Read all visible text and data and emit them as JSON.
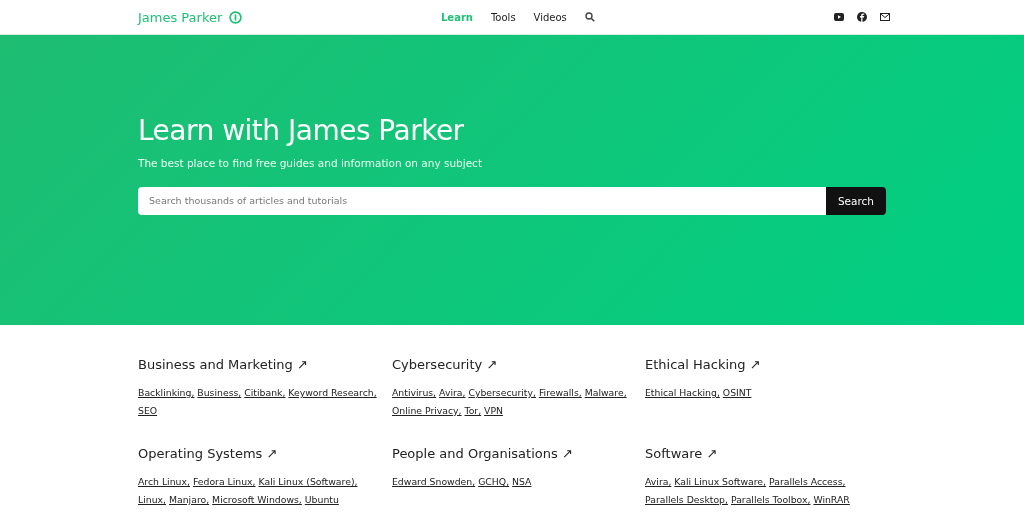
{
  "header": {
    "brand": "James Parker",
    "nav": [
      {
        "label": "Learn",
        "selected": true
      },
      {
        "label": "Tools",
        "selected": false
      },
      {
        "label": "Videos",
        "selected": false
      }
    ]
  },
  "hero": {
    "title": "Learn with James Parker",
    "subtitle": "The best place to find free guides and information on any subject",
    "search": {
      "placeholder": "Search thousands of articles and tutorials",
      "button": "Search"
    }
  },
  "categories": [
    {
      "title": "Business and Marketing ↗",
      "links": [
        "Backlinking,",
        "Business,",
        "Citibank,",
        "Keyword Research,",
        "SEO"
      ]
    },
    {
      "title": "Cybersecurity ↗",
      "links": [
        "Antivirus,",
        "Avira,",
        "Cybersecurity,",
        "Firewalls,",
        "Malware,",
        "Online Privacy,",
        "Tor,",
        "VPN"
      ]
    },
    {
      "title": "Ethical Hacking ↗",
      "links": [
        "Ethical Hacking,",
        "OSINT"
      ]
    },
    {
      "title": "Operating Systems ↗",
      "links": [
        "Arch Linux,",
        "Fedora Linux,",
        "Kali Linux (Software),",
        "Linux,",
        "Manjaro,",
        "Microsoft Windows,",
        "Ubuntu"
      ]
    },
    {
      "title": "People and Organisations ↗",
      "links": [
        "Edward Snowden,",
        "GCHQ,",
        "NSA"
      ]
    },
    {
      "title": "Software ↗",
      "links": [
        "Avira,",
        "Kali Linux Software,",
        "Parallels Access,",
        "Parallels Desktop,",
        "Parallels Toolbox,",
        "WinRAR"
      ]
    }
  ]
}
